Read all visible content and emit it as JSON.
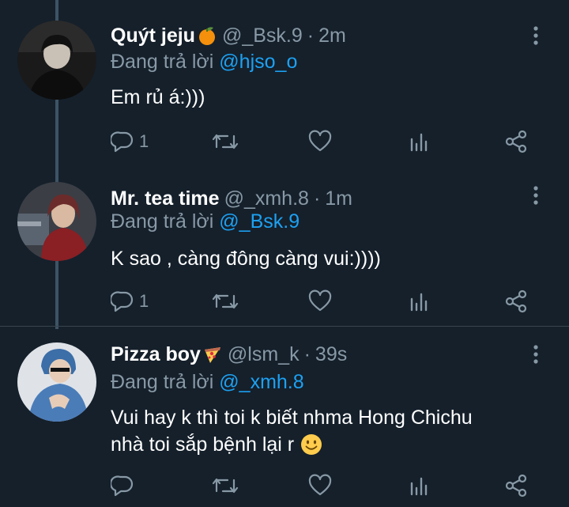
{
  "colors": {
    "background": "#15202b",
    "muted": "#8899a6",
    "accent": "#1da1f2",
    "thread_line": "#3d5466"
  },
  "tweets": [
    {
      "name": "Quýt jeju",
      "name_emoji": "tangerine-emoji",
      "handle": "@_Bsk.9",
      "separator": "·",
      "time": "2m",
      "replying_prefix": "Đang trả lời",
      "replying_to": "@hjso_o",
      "text": "Em rủ á:)))",
      "reply_count": "1"
    },
    {
      "name": "Mr. tea time",
      "handle": "@_xmh.8",
      "separator": "·",
      "time": "1m",
      "replying_prefix": "Đang trả lời",
      "replying_to": "@_Bsk.9",
      "text": "K sao , càng đông càng vui:))))",
      "reply_count": "1"
    },
    {
      "name": "Pizza boy",
      "name_emoji": "pizza-emoji",
      "handle": "@lsm_k",
      "separator": "·",
      "time": "39s",
      "replying_prefix": "Đang trả lời",
      "replying_to": "@_xmh.8",
      "text_line1": "Vui hay k thì toi k biết nhma Hong Chichu",
      "text_line2": "nhà toi sắp bệnh lại r",
      "text_emoji": "smiling-face-emoji",
      "reply_count": ""
    }
  ]
}
